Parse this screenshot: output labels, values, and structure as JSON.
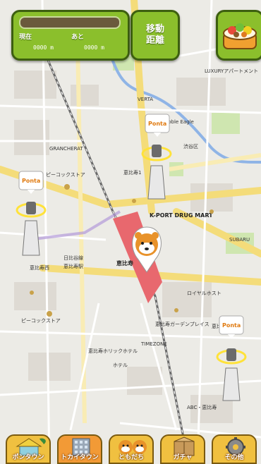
{
  "hud": {
    "current_label": "現在",
    "remaining_label": "あと",
    "current_value": "0000 m",
    "remaining_value": "0000 m",
    "progress_fraction": 0.0,
    "move_button_label_line1": "移動",
    "move_button_label_line2": "距離",
    "lunchbox_icon": "bento-icon"
  },
  "map": {
    "station_name": "恵比寿",
    "landmarks": {
      "l1": "ピーコックストア",
      "l2": "ピーコックストア",
      "l3": "K-PORT DRUG MART",
      "l4": "日比谷線",
      "l5": "恵比寿駅",
      "l6": "恵比寿ガーデンプレイス",
      "l7": "GRANCHERAT",
      "l8": "VERTA",
      "l9": "Noble Eagle",
      "l10": "恵比寿1",
      "l11": "恵比寿西",
      "l12": "ロイヤルホスト",
      "l13": "恵比寿ホリックホテル",
      "l14": "LUXURYアパートメント",
      "l15": "SUBARU",
      "l16": "ABC・恵比寿",
      "l17": "TIMEZONE",
      "l18": "恵比寿南",
      "l19": "渋谷区",
      "l20": "ホテル"
    },
    "ponta_pins": [
      {
        "label": "Ponta"
      },
      {
        "label": "Ponta"
      },
      {
        "label": "Ponta"
      }
    ]
  },
  "colors": {
    "accent_green": "#8bbf2c",
    "rail_pink": "#e8686e",
    "nav_gold": "#f0c040"
  },
  "nav": [
    {
      "label": "ポンタウン",
      "icon": "home-icon"
    },
    {
      "label": "トカイタウン",
      "icon": "building-icon"
    },
    {
      "label": "ともだち",
      "icon": "friends-icon"
    },
    {
      "label": "ガチャ",
      "icon": "gacha-box-icon"
    },
    {
      "label": "その他",
      "icon": "gear-icon"
    }
  ]
}
